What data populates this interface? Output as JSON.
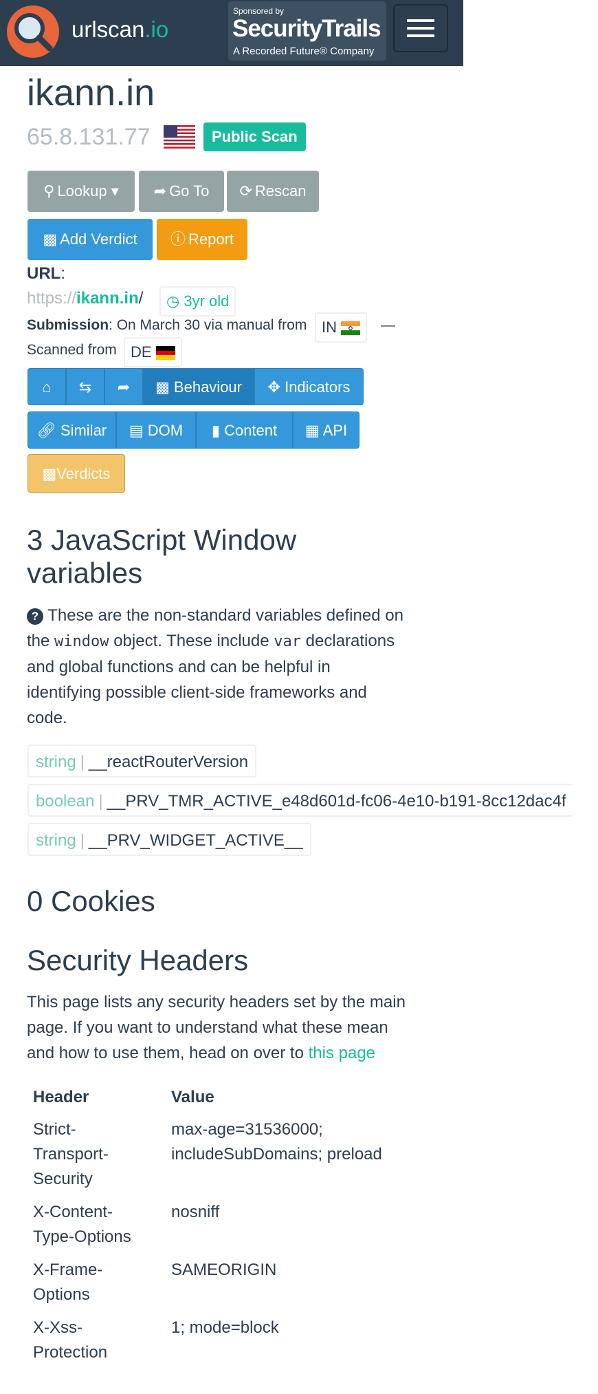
{
  "navbar": {
    "brand_name": "urlscan",
    "brand_tld": ".io",
    "sponsor_line1": "Sponsored by",
    "sponsor_line2": "SecurityTrails",
    "sponsor_line3": "A Recorded Future® Company"
  },
  "result": {
    "domain": "ikann.in",
    "ip": "65.8.131.77",
    "ip_country_flag": "us-flag-icon",
    "badge": "Public Scan"
  },
  "actions": {
    "lookup": "Lookup",
    "goto": "Go To",
    "rescan": "Rescan",
    "add_verdict": "Add Verdict",
    "report": "Report"
  },
  "url": {
    "label": "URL",
    "scheme": "https://",
    "host": "ikann.in",
    "path": "/",
    "age": "3yr old"
  },
  "submission": {
    "label": "Submission",
    "text": ": On March 30 via manual from",
    "from_country": "IN",
    "dash": "—",
    "scanned_text": "Scanned from",
    "scanned_country": "DE"
  },
  "tabs": {
    "behaviour": "Behaviour",
    "indicators": "Indicators",
    "similar": "Similar",
    "dom": "DOM",
    "content": "Content",
    "api": "API",
    "verdicts": "Verdicts"
  },
  "js_section": {
    "title_line1": "3 JavaScript Window",
    "title_line2": "variables",
    "desc_1": "These are the non-standard variables defined on",
    "desc_2a": "the",
    "desc_2_code1": "window",
    "desc_2b": "object. These include",
    "desc_2_code2": "var",
    "desc_2c": "declarations",
    "desc_3": "and global functions and can be helpful in",
    "desc_4": "identifying possible client-side frameworks and",
    "desc_5": "code.",
    "variables": [
      {
        "type": "string",
        "name": "__reactRouterVersion"
      },
      {
        "type": "boolean",
        "name": "__PRV_TMR_ACTIVE_e48d601d-fc06-4e10-b191-8cc12dac4f"
      },
      {
        "type": "string",
        "name": "__PRV_WIDGET_ACTIVE__"
      }
    ],
    "separator": "|"
  },
  "cookies": {
    "title": "0 Cookies"
  },
  "security_headers": {
    "title": "Security Headers",
    "desc_1": "This page lists any security headers set by the main",
    "desc_2": "page. If you want to understand what these mean",
    "desc_3": "and how to use them, head on over to",
    "link": "this page",
    "col_header": "Header",
    "col_value": "Value",
    "rows": [
      {
        "h1": "Strict-",
        "h2": "Transport-",
        "h3": "Security",
        "v1": "max-age=31536000;",
        "v2": "includeSubDomains; preload"
      },
      {
        "h1": "X-Content-",
        "h2": "Type-Options",
        "h3": "",
        "v1": "nosniff",
        "v2": ""
      },
      {
        "h1": "X-Frame-",
        "h2": "Options",
        "h3": "",
        "v1": "SAMEORIGIN",
        "v2": ""
      },
      {
        "h1": "X-Xss-",
        "h2": "Protection",
        "h3": "",
        "v1": "1; mode=block",
        "v2": ""
      }
    ]
  },
  "colors": {
    "navbar": "#2c3e50",
    "success": "#18bc9c",
    "primary": "#3498db",
    "warning": "#f39c12",
    "muted": "#95a5a6"
  }
}
